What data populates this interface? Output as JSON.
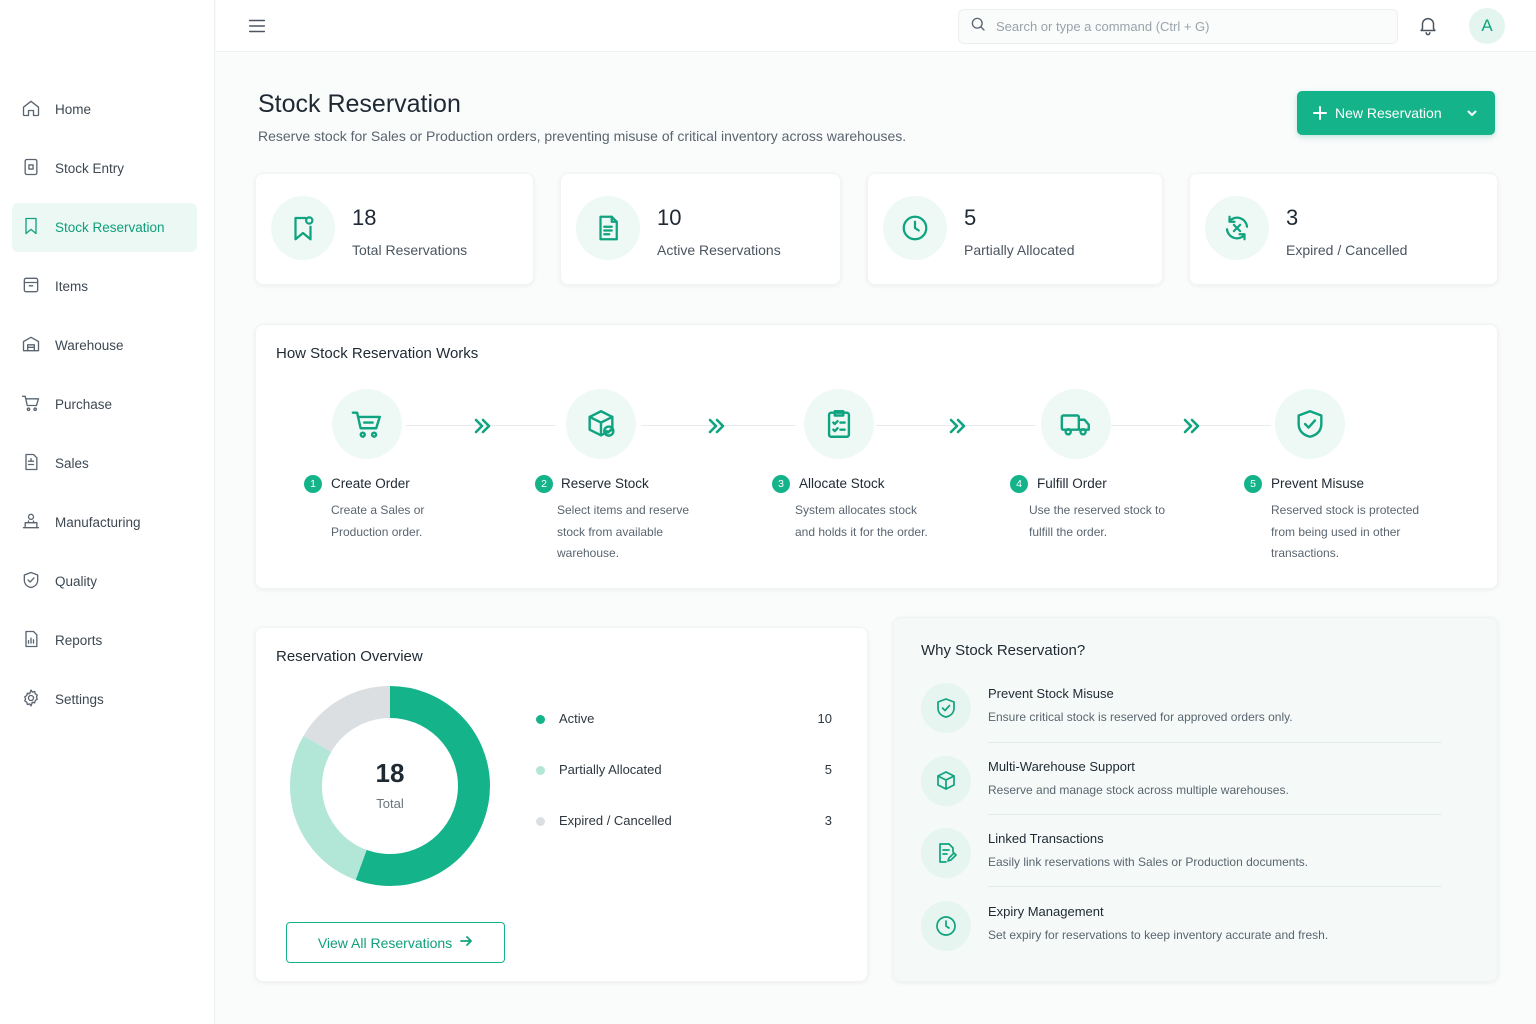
{
  "sidebar": {
    "items": [
      {
        "label": "Home",
        "icon": "home-icon"
      },
      {
        "label": "Stock Entry",
        "icon": "stock-entry-icon"
      },
      {
        "label": "Stock Reservation",
        "icon": "bookmark-icon",
        "active": true
      },
      {
        "label": "Items",
        "icon": "box-icon"
      },
      {
        "label": "Warehouse",
        "icon": "warehouse-icon"
      },
      {
        "label": "Purchase",
        "icon": "cart-icon"
      },
      {
        "label": "Sales",
        "icon": "invoice-icon"
      },
      {
        "label": "Manufacturing",
        "icon": "manufacturing-icon"
      },
      {
        "label": "Quality",
        "icon": "shield-check-icon"
      },
      {
        "label": "Reports",
        "icon": "report-icon"
      },
      {
        "label": "Settings",
        "icon": "gear-icon"
      }
    ]
  },
  "topbar": {
    "search_placeholder": "Search or type a command (Ctrl + G)",
    "avatar_initial": "A"
  },
  "header": {
    "title": "Stock Reservation",
    "subtitle": "Reserve stock for Sales or Production orders, preventing misuse of critical inventory across warehouses.",
    "new_button_label": "New Reservation"
  },
  "stats": [
    {
      "value": "18",
      "label": "Total Reservations",
      "icon": "bookmark-icon"
    },
    {
      "value": "10",
      "label": "Active Reservations",
      "icon": "document-icon"
    },
    {
      "value": "5",
      "label": "Partially Allocated",
      "icon": "clock-icon"
    },
    {
      "value": "3",
      "label": "Expired / Cancelled",
      "icon": "sync-cancel-icon"
    }
  ],
  "how": {
    "title": "How Stock Reservation Works",
    "steps": [
      {
        "num": "1",
        "title": "Create Order",
        "desc": "Create a Sales or Production order.",
        "icon": "cart-icon"
      },
      {
        "num": "2",
        "title": "Reserve Stock",
        "desc": "Select items and reserve stock from available warehouse.",
        "icon": "box-check-icon"
      },
      {
        "num": "3",
        "title": "Allocate Stock",
        "desc": "System allocates stock and holds it for the order.",
        "icon": "clipboard-icon"
      },
      {
        "num": "4",
        "title": "Fulfill Order",
        "desc": "Use the reserved stock to fulfill the order.",
        "icon": "truck-icon"
      },
      {
        "num": "5",
        "title": "Prevent Misuse",
        "desc": "Reserved stock is protected from being used in other transactions.",
        "icon": "shield-check-icon"
      }
    ]
  },
  "overview": {
    "title": "Reservation Overview",
    "total": "18",
    "total_label": "Total",
    "button_label": "View All Reservations",
    "legend": [
      {
        "label": "Active",
        "value": "10",
        "color": "#14b38a"
      },
      {
        "label": "Partially Allocated",
        "value": "5",
        "color": "#b2e6d6"
      },
      {
        "label": "Expired / Cancelled",
        "value": "3",
        "color": "#dcdfe1"
      }
    ]
  },
  "why": {
    "title": "Why Stock Reservation?",
    "items": [
      {
        "title": "Prevent Stock Misuse",
        "desc": "Ensure critical stock is reserved for approved orders only.",
        "icon": "shield-check-icon"
      },
      {
        "title": "Multi-Warehouse Support",
        "desc": "Reserve and manage stock across multiple warehouses.",
        "icon": "box-icon"
      },
      {
        "title": "Linked Transactions",
        "desc": "Easily link reservations with Sales or Production documents.",
        "icon": "document-edit-icon"
      },
      {
        "title": "Expiry Management",
        "desc": "Set expiry for reservations to keep inventory accurate and fresh.",
        "icon": "clock-icon"
      }
    ]
  },
  "colors": {
    "accent": "#14b38a",
    "accent_light": "#b2e6d6",
    "muted": "#dcdfe1"
  }
}
